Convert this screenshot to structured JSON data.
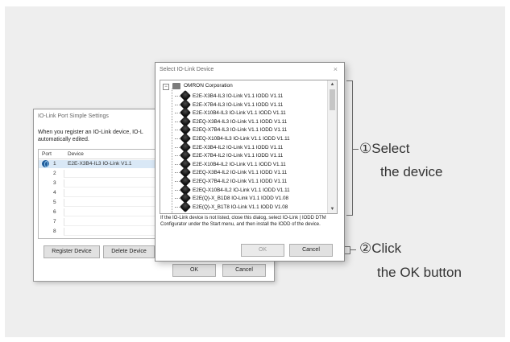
{
  "back_dialog": {
    "title": "IO-Link Port Simple Settings",
    "description": "When you register an IO-Link device, IO-L automatically edited.",
    "columns": [
      "Port",
      "Device"
    ],
    "ports": [
      {
        "num": "1",
        "device": "E2E-X3B4-IL3 IO-Link V1.1"
      },
      {
        "num": "2",
        "device": ""
      },
      {
        "num": "3",
        "device": ""
      },
      {
        "num": "4",
        "device": ""
      },
      {
        "num": "5",
        "device": ""
      },
      {
        "num": "6",
        "device": ""
      },
      {
        "num": "7",
        "device": ""
      },
      {
        "num": "8",
        "device": ""
      }
    ],
    "register_label": "Register Device",
    "delete_label": "Delete Device",
    "ok_label": "OK",
    "cancel_label": "Cancel"
  },
  "front_dialog": {
    "title": "Select IO-Link Device",
    "close": "×",
    "root": "OMRON Corporation",
    "items": [
      "E2E-X3B4-IL3 IO-Link V1.1 IODD V1.11",
      "E2E-X7B4-IL3 IO-Link V1.1 IODD V1.11",
      "E2E-X10B4-IL3 IO-Link V1.1 IODD V1.11",
      "E2EQ-X3B4-IL3 IO-Link V1.1 IODD V1.11",
      "E2EQ-X7B4-IL3 IO-Link V1.1 IODD V1.11",
      "E2EQ-X10B4-IL3 IO-Link V1.1 IODD V1.11",
      "E2E-X3B4-IL2 IO-Link V1.1 IODD V1.11",
      "E2E-X7B4-IL2 IO-Link V1.1 IODD V1.11",
      "E2E-X10B4-IL2 IO-Link V1.1 IODD V1.11",
      "E2EQ-X3B4-IL2 IO-Link V1.1 IODD V1.11",
      "E2EQ-X7B4-IL2 IO-Link V1.1 IODD V1.11",
      "E2EQ-X10B4-IL2 IO-Link V1.1 IODD V1.11",
      "E2E(Q)-X_B1D8 IO-Link V1.1 IODD V1.08",
      "E2E(Q)-X_B1T8 IO-Link V1.1 IODD V1.08"
    ],
    "note": "If the IO-Link device is not listed, close this dialog, select IO-Link | IODD DTM Configurator under the Start menu, and then install the IODD of the device.",
    "ok_label": "OK",
    "cancel_label": "Cancel"
  },
  "callouts": {
    "select_line1": "①Select",
    "select_line2": "the device",
    "click_line1": "②Click",
    "click_line2": "the OK button"
  }
}
